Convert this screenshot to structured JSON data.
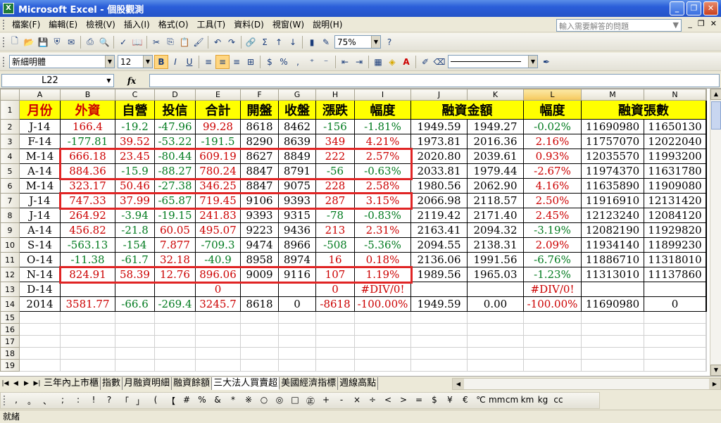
{
  "window": {
    "title": "Microsoft Excel - 個股觀測"
  },
  "menu": {
    "items": [
      "檔案(F)",
      "編輯(E)",
      "檢視(V)",
      "插入(I)",
      "格式(O)",
      "工具(T)",
      "資料(D)",
      "視窗(W)",
      "說明(H)"
    ],
    "help_placeholder": "輸入需要解答的問題"
  },
  "toolbar": {
    "zoom": "75%"
  },
  "format": {
    "font": "新細明體",
    "size": "12",
    "bold": "B",
    "italic": "I",
    "underline": "U",
    "currency": "$",
    "percent": "%"
  },
  "formula_bar": {
    "cell_ref": "L22",
    "fx": "fx",
    "content": ""
  },
  "columns": [
    "A",
    "B",
    "C",
    "D",
    "E",
    "F",
    "G",
    "H",
    "I",
    "J",
    "K",
    "L",
    "M",
    "N"
  ],
  "selected_column": "L",
  "header_row": [
    "月份",
    "外資",
    "自營",
    "投信",
    "合計",
    "開盤",
    "收盤",
    "漲跌",
    "幅度",
    "融資金額",
    "",
    "幅度",
    "融資張數",
    ""
  ],
  "rows": [
    {
      "n": "2",
      "cells": [
        "J-14",
        "166.4",
        "-19.2",
        "-47.96",
        "99.28",
        "8618",
        "8462",
        "-156",
        "-1.81%",
        "1949.59",
        "1949.27",
        "-0.02%",
        "11690980",
        "11650130"
      ],
      "colors": [
        "b",
        "r",
        "g",
        "g",
        "r",
        "b",
        "b",
        "g",
        "g",
        "b",
        "b",
        "g",
        "b",
        "b"
      ]
    },
    {
      "n": "3",
      "cells": [
        "F-14",
        "-177.81",
        "39.52",
        "-53.22",
        "-191.5",
        "8290",
        "8639",
        "349",
        "4.21%",
        "1973.81",
        "2016.36",
        "2.16%",
        "11757070",
        "12022040"
      ],
      "colors": [
        "b",
        "g",
        "r",
        "g",
        "g",
        "b",
        "b",
        "r",
        "r",
        "b",
        "b",
        "r",
        "b",
        "b"
      ]
    },
    {
      "n": "4",
      "cells": [
        "M-14",
        "666.18",
        "23.45",
        "-80.44",
        "609.19",
        "8627",
        "8849",
        "222",
        "2.57%",
        "2020.80",
        "2039.61",
        "0.93%",
        "12035570",
        "11993200"
      ],
      "colors": [
        "b",
        "r",
        "r",
        "g",
        "r",
        "b",
        "b",
        "r",
        "r",
        "b",
        "b",
        "r",
        "b",
        "b"
      ]
    },
    {
      "n": "5",
      "cells": [
        "A-14",
        "884.36",
        "-15.9",
        "-88.27",
        "780.24",
        "8847",
        "8791",
        "-56",
        "-0.63%",
        "2033.81",
        "1979.44",
        "-2.67%",
        "11974370",
        "11631780"
      ],
      "colors": [
        "b",
        "r",
        "g",
        "g",
        "r",
        "b",
        "b",
        "g",
        "g",
        "b",
        "b",
        "r",
        "b",
        "b"
      ]
    },
    {
      "n": "6",
      "cells": [
        "M-14",
        "323.17",
        "50.46",
        "-27.38",
        "346.25",
        "8847",
        "9075",
        "228",
        "2.58%",
        "1980.56",
        "2062.90",
        "4.16%",
        "11635890",
        "11909080"
      ],
      "colors": [
        "b",
        "r",
        "r",
        "g",
        "r",
        "b",
        "b",
        "r",
        "r",
        "b",
        "b",
        "r",
        "b",
        "b"
      ]
    },
    {
      "n": "7",
      "cells": [
        "J-14",
        "747.33",
        "37.99",
        "-65.87",
        "719.45",
        "9106",
        "9393",
        "287",
        "3.15%",
        "2066.98",
        "2118.57",
        "2.50%",
        "11916910",
        "12131420"
      ],
      "colors": [
        "b",
        "r",
        "r",
        "g",
        "r",
        "b",
        "b",
        "r",
        "r",
        "b",
        "b",
        "r",
        "b",
        "b"
      ]
    },
    {
      "n": "8",
      "cells": [
        "J-14",
        "264.92",
        "-3.94",
        "-19.15",
        "241.83",
        "9393",
        "9315",
        "-78",
        "-0.83%",
        "2119.42",
        "2171.40",
        "2.45%",
        "12123240",
        "12084120"
      ],
      "colors": [
        "b",
        "r",
        "g",
        "g",
        "r",
        "b",
        "b",
        "g",
        "g",
        "b",
        "b",
        "r",
        "b",
        "b"
      ]
    },
    {
      "n": "9",
      "cells": [
        "A-14",
        "456.82",
        "-21.8",
        "60.05",
        "495.07",
        "9223",
        "9436",
        "213",
        "2.31%",
        "2163.41",
        "2094.32",
        "-3.19%",
        "12082190",
        "11929820"
      ],
      "colors": [
        "b",
        "r",
        "g",
        "r",
        "r",
        "b",
        "b",
        "r",
        "r",
        "b",
        "b",
        "g",
        "b",
        "b"
      ]
    },
    {
      "n": "10",
      "cells": [
        "S-14",
        "-563.13",
        "-154",
        "7.877",
        "-709.3",
        "9474",
        "8966",
        "-508",
        "-5.36%",
        "2094.55",
        "2138.31",
        "2.09%",
        "11934140",
        "11899230"
      ],
      "colors": [
        "b",
        "g",
        "g",
        "r",
        "g",
        "b",
        "b",
        "g",
        "g",
        "b",
        "b",
        "r",
        "b",
        "b"
      ]
    },
    {
      "n": "11",
      "cells": [
        "O-14",
        "-11.38",
        "-61.7",
        "32.18",
        "-40.9",
        "8958",
        "8974",
        "16",
        "0.18%",
        "2136.06",
        "1991.56",
        "-6.76%",
        "11886710",
        "11318010"
      ],
      "colors": [
        "b",
        "g",
        "g",
        "r",
        "g",
        "b",
        "b",
        "r",
        "r",
        "b",
        "b",
        "g",
        "b",
        "b"
      ]
    },
    {
      "n": "12",
      "cells": [
        "N-14",
        "824.91",
        "58.39",
        "12.76",
        "896.06",
        "9009",
        "9116",
        "107",
        "1.19%",
        "1989.56",
        "1965.03",
        "-1.23%",
        "11313010",
        "11137860"
      ],
      "colors": [
        "b",
        "r",
        "r",
        "r",
        "r",
        "b",
        "b",
        "r",
        "r",
        "b",
        "b",
        "g",
        "b",
        "b"
      ]
    },
    {
      "n": "13",
      "cells": [
        "D-14",
        "",
        "",
        "",
        "0",
        "",
        "",
        "0",
        "#DIV/0!",
        "",
        "",
        "#DIV/0!",
        "",
        ""
      ],
      "colors": [
        "b",
        "b",
        "b",
        "b",
        "r",
        "b",
        "b",
        "r",
        "r",
        "b",
        "b",
        "r",
        "b",
        "b"
      ]
    },
    {
      "n": "14",
      "cells": [
        "2014",
        "3581.77",
        "-66.6",
        "-269.4",
        "3245.7",
        "8618",
        "0",
        "-8618",
        "-100.00%",
        "1949.59",
        "0.00",
        "-100.00%",
        "11690980",
        "0"
      ],
      "colors": [
        "b",
        "r",
        "g",
        "g",
        "r",
        "b",
        "b",
        "r",
        "r",
        "b",
        "b",
        "r",
        "b",
        "b"
      ]
    }
  ],
  "empty_rows": [
    "15",
    "16",
    "17",
    "18",
    "19"
  ],
  "highlighted_row_groups": [
    [
      "4",
      "5"
    ],
    [
      "7"
    ],
    [
      "12"
    ]
  ],
  "sheet_tabs": [
    "三年內上市櫃",
    "指數",
    "月融資明細",
    "融資餘額",
    "三大法人買賣超",
    "美國經濟指標",
    "週線高點"
  ],
  "active_tab": "三大法人買賣超",
  "symbols": [
    ",",
    "。",
    "、",
    ";",
    ":",
    "!",
    "?",
    "「",
    "」",
    "(",
    "【",
    "#",
    "%",
    "&",
    "*",
    "※",
    "○",
    "◎",
    "□",
    "㊣",
    "+",
    "-",
    "×",
    "÷",
    "<",
    ">",
    "=",
    "$",
    "¥",
    "€",
    "℃",
    "mm",
    "cm",
    "km",
    "kg",
    "cc"
  ],
  "status": "就緒",
  "colors": {
    "red": "#cc0000",
    "green": "#007a1e",
    "header_fill": "#ffff00",
    "highlight_box": "#e02424"
  }
}
